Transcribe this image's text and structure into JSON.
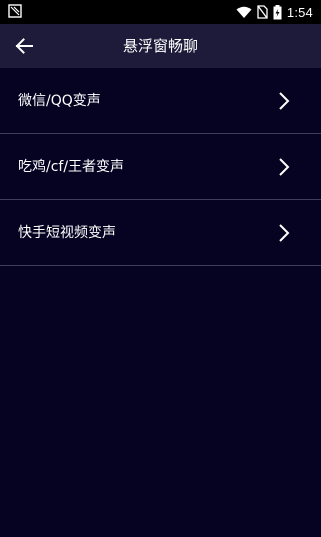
{
  "status_bar": {
    "time": "1:54",
    "icons": [
      "notification-icon",
      "wifi-icon",
      "no-sim-icon",
      "battery-charging-icon"
    ]
  },
  "toolbar": {
    "title": "悬浮窗畅聊",
    "back_icon": "arrow-left-icon"
  },
  "list": {
    "items": [
      {
        "label": "微信/QQ变声"
      },
      {
        "label": "吃鸡/cf/王者变声"
      },
      {
        "label": "快手短视频变声"
      }
    ]
  },
  "colors": {
    "background": "#050321",
    "toolbar": "#1d1b39",
    "divider": "#3e3c5a",
    "text": "#ffffff"
  }
}
